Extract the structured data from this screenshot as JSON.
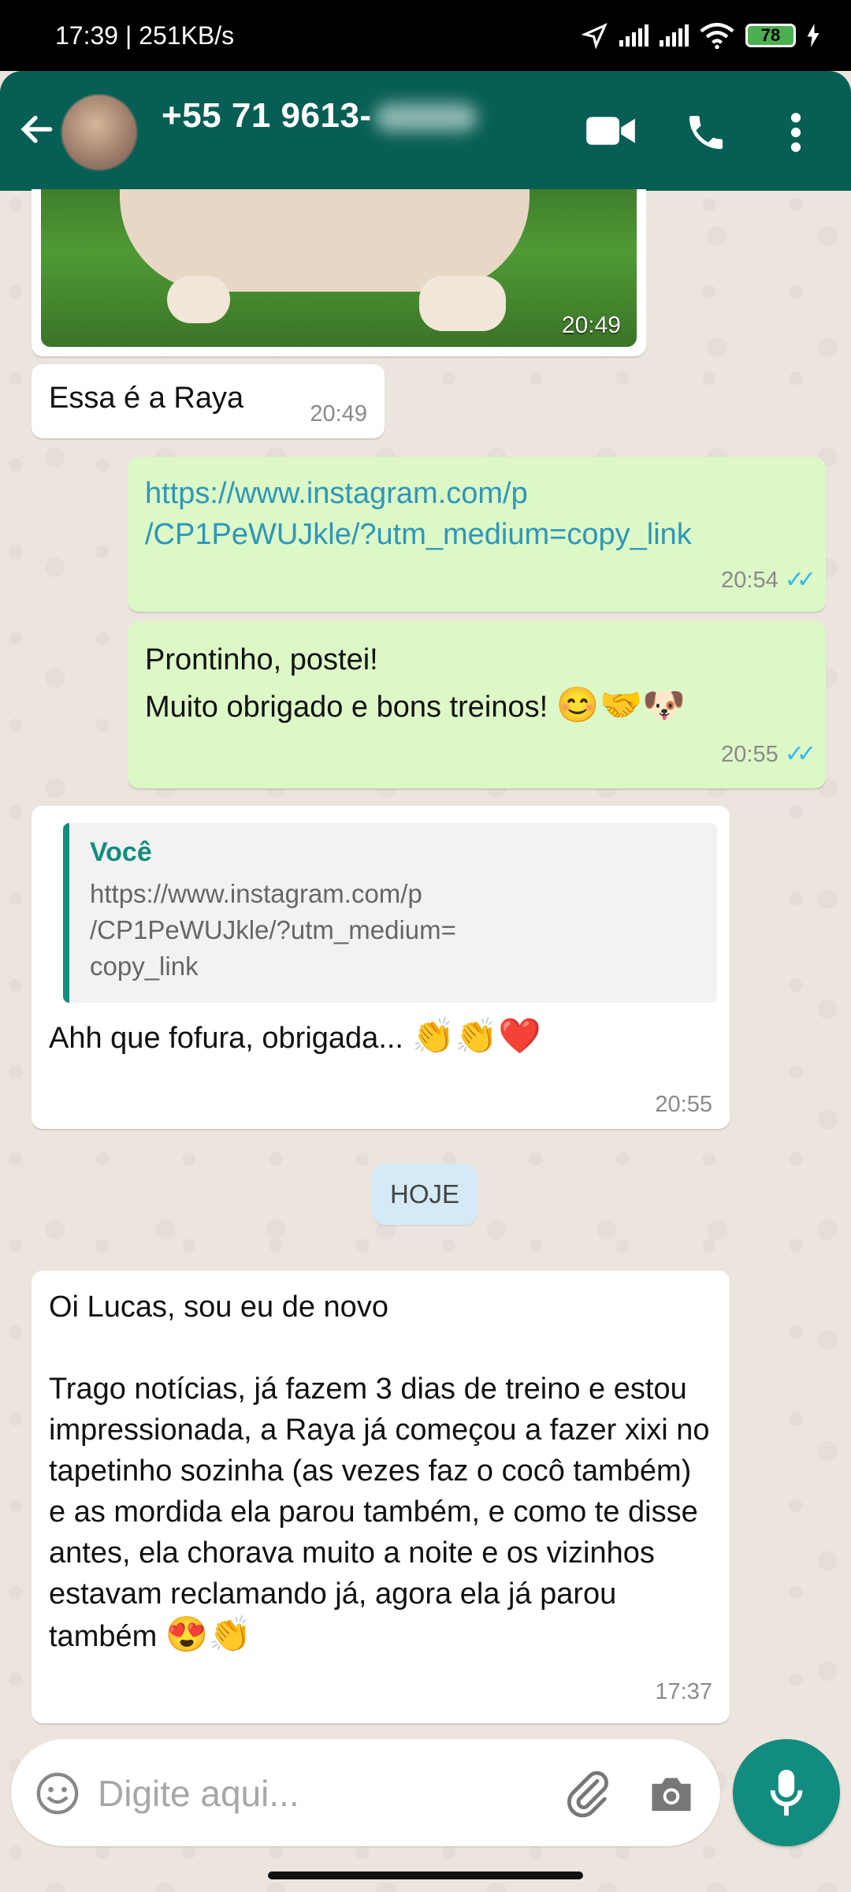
{
  "status_bar": {
    "left": "17:39 | 251KB/s",
    "battery": "78"
  },
  "header": {
    "contact_name": "+55 71 9613-"
  },
  "messages": [
    {
      "id": "photo",
      "time": "20:49"
    },
    {
      "id": "raya",
      "text": "Essa é a Raya",
      "time": "20:49"
    },
    {
      "id": "link",
      "line1": "https://www.instagram.com/p",
      "line2": "/CP1PeWUJkle/?utm_medium=copy_link",
      "time": "20:54"
    },
    {
      "id": "postei",
      "line1": "Prontinho, postei!",
      "line2": "Muito obrigado e bons treinos!",
      "emojis": "😊🤝🐶",
      "time": "20:55"
    },
    {
      "id": "reply",
      "quote_author": "Você",
      "quote_text": "https://www.instagram.com/p\n/CP1PeWUJkle/?utm_medium=\ncopy_link",
      "text": "Ahh que fofura, obrigada...",
      "emojis": "👏👏❤️",
      "time": "20:55"
    },
    {
      "id": "long",
      "line1": "Oi Lucas, sou eu de novo",
      "body": "Trago notícias, já fazem 3 dias de treino e estou impressionada, a Raya já começou a fazer xixi no tapetinho sozinha (as vezes faz o cocô também) e as mordida ela parou também, e como te disse antes, ela chorava muito a noite e os vizinhos estavam reclamando já, agora ela já parou também",
      "emojis": "😍👏",
      "time": "17:37"
    }
  ],
  "date_chip": "HOJE",
  "composer": {
    "placeholder": "Digite aqui..."
  },
  "colors": {
    "header": "#075e54",
    "outgoing": "#dcf8c6",
    "accent": "#128c7e",
    "read_ticks": "#34b7f1"
  },
  "icons": [
    "back-arrow-icon",
    "video-call-icon",
    "phone-icon",
    "more-vert-icon",
    "emoji-icon",
    "attach-icon",
    "camera-icon",
    "mic-icon",
    "double-check-icon"
  ]
}
